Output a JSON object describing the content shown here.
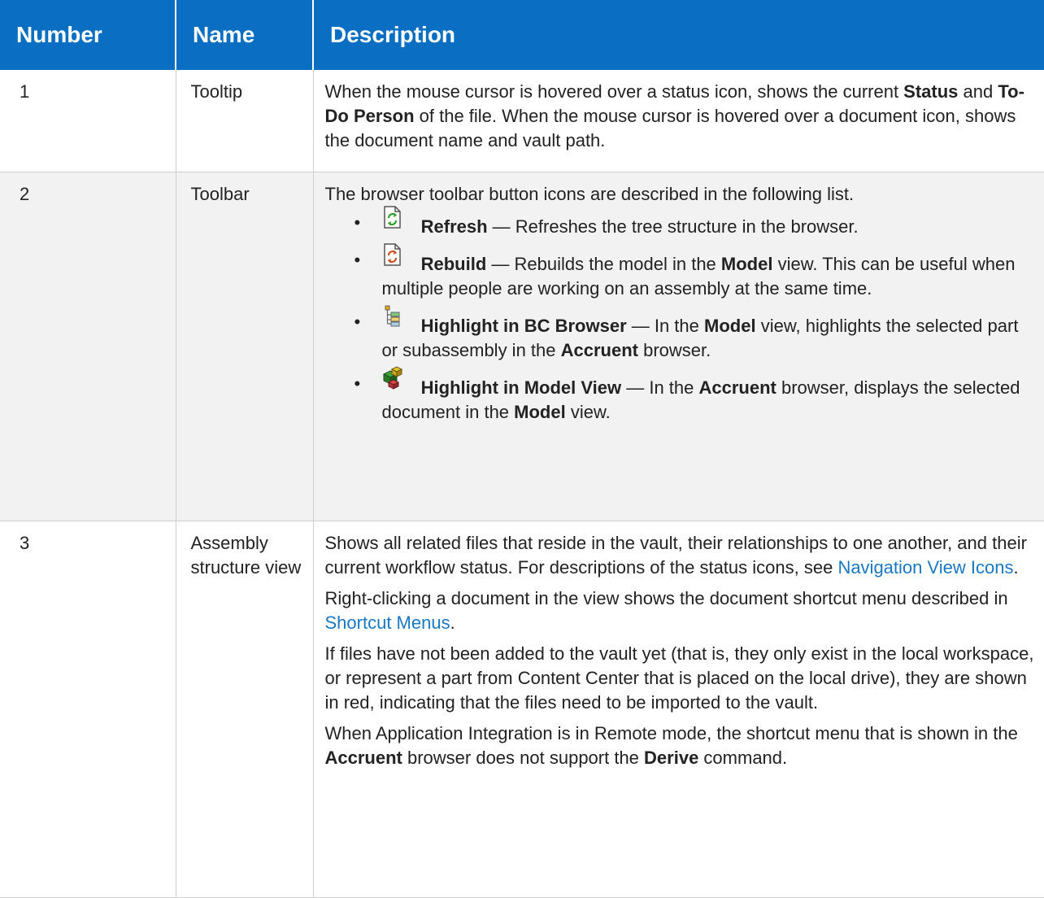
{
  "header": {
    "col_number": "Number",
    "col_name": "Name",
    "col_description": "Description"
  },
  "rows": [
    {
      "number": "1",
      "name": "Tooltip",
      "desc": {
        "t1": "When the mouse cursor is hovered over a status icon, shows the current ",
        "b1": "Status",
        "t2": " and ",
        "b2": "To-Do Person",
        "t3": " of the file. When the mouse cursor is hovered over a document icon, shows the document name and vault path."
      }
    },
    {
      "number": "2",
      "name": "Toolbar",
      "intro": "The browser toolbar button icons are described in the following list.",
      "items": [
        {
          "icon": "refresh-icon",
          "label": "Refresh",
          "t1": " — Refreshes the tree structure in the browser."
        },
        {
          "icon": "rebuild-icon",
          "label": "Rebuild",
          "t1": " — Rebuilds the model in the ",
          "b1": "Model",
          "t2": " view. This can be useful when multiple people are working on an assembly at the same time."
        },
        {
          "icon": "highlight-in-bc-browser-icon",
          "label": "Highlight in BC Browser",
          "t1": " — In the ",
          "b1": "Model",
          "t2": " view, highlights the selected part or subassembly in the ",
          "b2": "Accruent",
          "t3": " browser."
        },
        {
          "icon": "highlight-in-model-view-icon",
          "label": "Highlight in Model View",
          "t1": " — In the ",
          "b1": "Accruent",
          "t2": " browser, displays the selected document in the ",
          "b2": "Model",
          "t3": " view."
        }
      ]
    },
    {
      "number": "3",
      "name": "Assembly structure view",
      "p1": {
        "t1": "Shows all related files that reside in the vault, their relationships to one another, and their current workflow status. For descriptions of the status icons, see ",
        "link": "Navigation View Icons",
        "t2": "."
      },
      "p2": {
        "t1": "Right-clicking a document in the view shows the document shortcut menu described in ",
        "link": "Shortcut Menus",
        "t2": "."
      },
      "p3": "If files have not been added to the vault yet (that is, they only exist in the local workspace, or represent a part from Content Center that is placed on the local drive), they are shown in red, indicating that the files need to be imported to the vault.",
      "p4": {
        "t1": "When Application Integration is in Remote mode, the shortcut menu that is shown in the ",
        "b1": "Accruent",
        "t2": " browser does not support the ",
        "b2": "Derive",
        "t3": " command."
      }
    }
  ],
  "colors": {
    "header_bg": "#0a6fc2",
    "link": "#1a78c2",
    "row_alt_bg": "#f2f2f2"
  }
}
